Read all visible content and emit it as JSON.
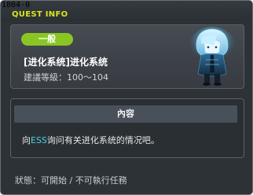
{
  "top_label": "1804-0",
  "window": {
    "title": "QUEST INFO"
  },
  "quest": {
    "category": "一般",
    "name": "[进化系统]进化系统",
    "level_requirement": "建議等級：100～104"
  },
  "npc": {
    "icon": "npc-portrait-icon"
  },
  "content": {
    "header": "內容",
    "desc_before": "向",
    "desc_npc": "ESS",
    "desc_after": "询问有关进化系统的情况吧。"
  },
  "status": {
    "text": "狀態：可開始 / 不可執行任務"
  },
  "colors": {
    "title": "#d8e71a",
    "badge": "#89c624",
    "npc_name": "#4fd3e6",
    "window_bg": "#2d3237"
  }
}
